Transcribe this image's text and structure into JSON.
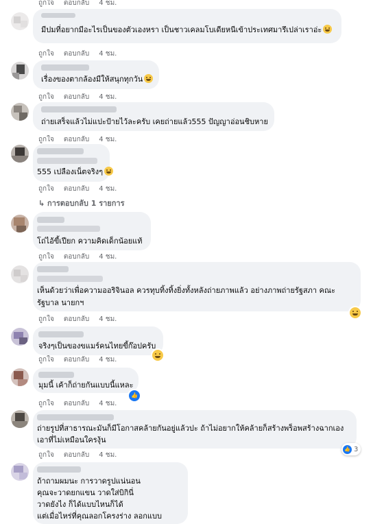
{
  "actions": {
    "like": "ถูกใจ",
    "reply": "ตอบกลับ"
  },
  "comments": [
    {
      "lines": [
        "มีปมที่อยากมีอะไรเป็นของตัวเองหรา เป็นชาวเคลมโบเดียหนีเข้าประเทศมารึเปล่าเราอ่ะ"
      ],
      "time": "4 ชม."
    },
    {
      "lines": [
        "เรื่องของตากล้องมีให้สนุกทุกวัน"
      ],
      "time": "4 ชม."
    },
    {
      "lines": [
        "ถ่ายเสร็จแล้วไม่แปะป้ายไว้ละครับ เคยถ่ายแล้ว555 ปัญญาอ่อนชิบหาย"
      ],
      "time": "4 ชม."
    },
    {
      "lines": [
        "555 เปลืองเน็ตจริงๆ"
      ],
      "time": "4 ชม."
    },
    {
      "lines": [
        "โถ่ไอ้ขี้เปียก ความคิดเด็กน้อยแท้"
      ],
      "time": "4 ชม."
    },
    {
      "lines": [
        "เห็นด้วยว่าเพื่อความออริจินอล ควรทุบทิ้งทิ้งยิ่งทั้งหลังถ่ายภาพแล้ว อย่างภาพถ่ายรัฐสภา คณะ",
        "รัฐบาล นายกฯ"
      ],
      "time": "4 ชม."
    },
    {
      "lines": [
        "จริงๆเป็นของขแมร์คนไทยขี้ก๊อปครับ"
      ],
      "time": "4 ชม."
    },
    {
      "lines": [
        "มุมนี้ เค้าก็ถ่ายกันแบบนี้แหละ"
      ],
      "time": "4 ชม."
    },
    {
      "lines": [
        "ถ่ายรูปที่สาธารณะมันก็มีโอกาสคล้ายกันอยู่แล้วปะ ถ้าไม่อยากให้คล้ายก็สร้างพร็อพสร้างฉากเอง",
        "เอาที่ไม่เหมือนใครงุ้น"
      ],
      "time": "4 ชม.",
      "reaction_count": "3"
    },
    {
      "lines": [
        "ถ้าถามผมนะ การวาดรูปแน่นอน",
        "คุณจะวาดยกแขน วาดใส่บิกินี่",
        "วาดยังไง ก็ได้แบบไหนก็ได้",
        "แต่เมื่อไหร่ที่คุณลอกโครงร่าง ลอกแบบ"
      ]
    }
  ],
  "top_time": "4 ชม.",
  "replies_link": "การตอบกลับ 1 รายการ"
}
